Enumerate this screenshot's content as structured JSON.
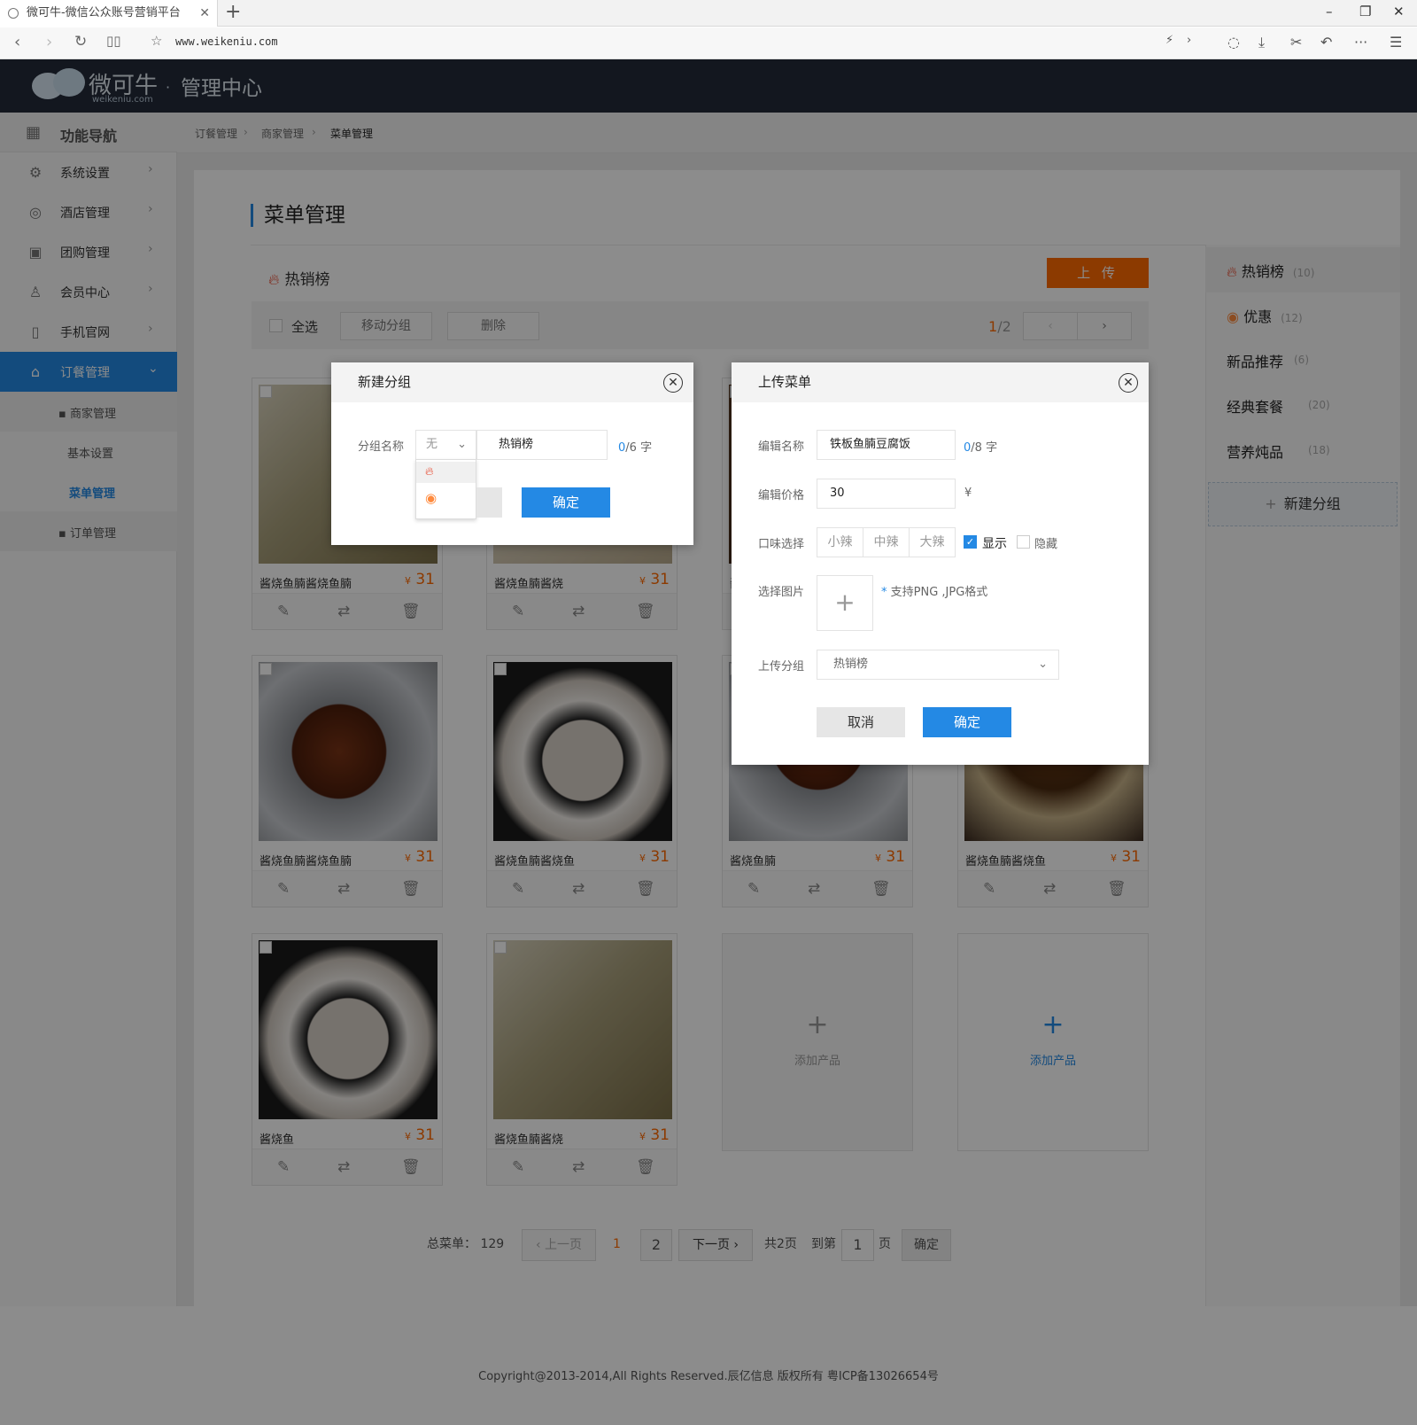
{
  "browser": {
    "tab_title": "微可牛-微信公众账号营销平台",
    "url": "www.weikeniu.com"
  },
  "header": {
    "logo_cn": "微可牛",
    "logo_en": "weikeniu.com",
    "center_title": "管理中心"
  },
  "sidebar": {
    "head": "功能导航",
    "items": [
      {
        "label": "系统设置",
        "icon": "gear-icon"
      },
      {
        "label": "酒店管理",
        "icon": "hotel-icon"
      },
      {
        "label": "团购管理",
        "icon": "gift-icon"
      },
      {
        "label": "会员中心",
        "icon": "vip-user-icon"
      },
      {
        "label": "手机官网",
        "icon": "phone-icon"
      },
      {
        "label": "订餐管理",
        "icon": "bell-icon"
      }
    ],
    "subitems": [
      "▪ 商家管理",
      "基本设置",
      "菜单管理",
      "▪ 订单管理"
    ]
  },
  "breadcrumb": [
    "订餐管理",
    "商家管理",
    "菜单管理"
  ],
  "page": {
    "title": "菜单管理",
    "section": "热销榜",
    "upload_label": "上 传",
    "toolbar": {
      "select_all": "全选",
      "move": "移动分组",
      "delete": "删除",
      "page_cur": "1",
      "page_total": "/2"
    }
  },
  "cards": [
    {
      "name": "酱烧鱼腩酱烧鱼腩",
      "price": "31",
      "currency": "¥"
    },
    {
      "name": "酱烧鱼腩酱烧",
      "price": "31",
      "currency": "¥"
    },
    {
      "name": "酱烧鱼腩酱烧",
      "price": "31",
      "currency": "¥"
    },
    {
      "name": "酱烧鱼腩酱烧鱼",
      "price": "31",
      "currency": "¥"
    },
    {
      "name": "酱烧鱼腩酱烧鱼腩",
      "price": "31",
      "currency": "¥"
    },
    {
      "name": "酱烧鱼腩",
      "price": "31",
      "currency": "¥"
    },
    {
      "name": "酱烧鱼",
      "price": "31",
      "currency": "¥"
    },
    {
      "name": "酱烧鱼腩酱烧",
      "price": "31",
      "currency": "¥"
    }
  ],
  "add_product": "添加产品",
  "groups": [
    {
      "label": "热销榜",
      "count": "(10)"
    },
    {
      "label": "优惠",
      "count": "(12)"
    },
    {
      "label": "新品推荐",
      "count": "(6)"
    },
    {
      "label": "经典套餐",
      "count": "(20)"
    },
    {
      "label": "营养炖品",
      "count": "(18)"
    }
  ],
  "new_group": "新建分组",
  "pagination": {
    "total_label": "总菜单：",
    "total": "129",
    "prev": "上一页",
    "p1": "1",
    "p2": "2",
    "next": "下一页",
    "pages": "共2页",
    "goto": "到第",
    "goto_val": "1",
    "page_unit": "页",
    "confirm": "确定"
  },
  "footer": "Copyright@2013-2014,All Rights Reserved.辰亿信息 版权所有 粤ICP备13026654号",
  "dialog_group": {
    "title": "新建分组",
    "label": "分组名称",
    "select": "无",
    "value": "热销榜",
    "count_cur": "0",
    "count_max": "/6 字",
    "confirm": "确定"
  },
  "dialog_upload": {
    "title": "上传菜单",
    "name_label": "编辑名称",
    "name_value": "铁板鱼腩豆腐饭",
    "name_cur": "0",
    "name_max": "/8 字",
    "price_label": "编辑价格",
    "price_value": "30",
    "price_unit": "¥",
    "taste_label": "口味选择",
    "tastes": [
      "小辣",
      "中辣",
      "大辣"
    ],
    "show": "显示",
    "hide": "隐藏",
    "image_label": "选择图片",
    "image_hint": "支持PNG ,JPG格式",
    "group_label": "上传分组",
    "group_value": "热销榜",
    "cancel": "取消",
    "confirm": "确定"
  },
  "colors": {
    "accent": "#2489e4",
    "orange": "#ff6a00",
    "header": "#242b3a"
  }
}
